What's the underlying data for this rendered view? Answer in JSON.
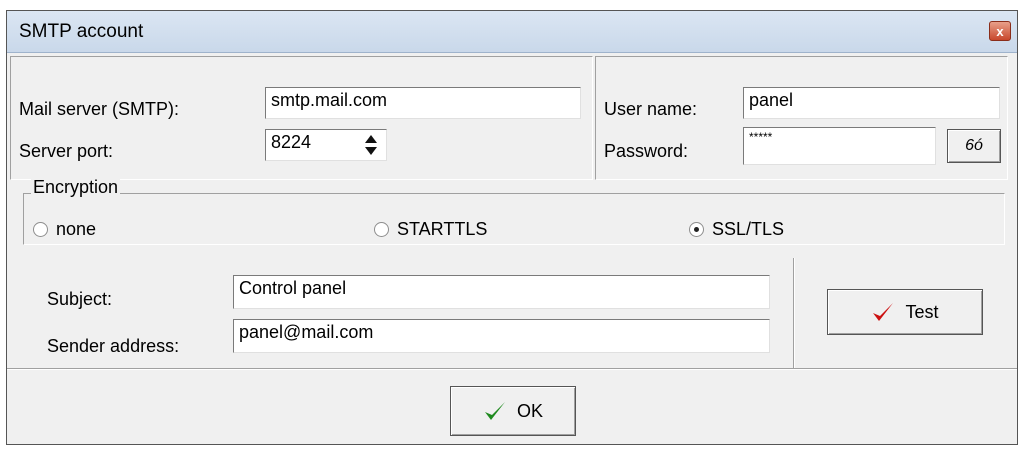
{
  "window": {
    "title": "SMTP account",
    "close_label": "x"
  },
  "server": {
    "mail_server_label": "Mail server (SMTP):",
    "mail_server_value": "smtp.mail.com",
    "port_label": "Server port:",
    "port_value": "8224"
  },
  "auth": {
    "user_label": "User name:",
    "user_value": "panel",
    "password_label": "Password:",
    "password_value": "*****",
    "reveal_label": "6ó"
  },
  "encryption": {
    "group_label": "Encryption",
    "options": [
      {
        "label": "none",
        "selected": false
      },
      {
        "label": "STARTTLS",
        "selected": false
      },
      {
        "label": "SSL/TLS",
        "selected": true
      }
    ]
  },
  "message": {
    "subject_label": "Subject:",
    "subject_value": "Control panel",
    "sender_label": "Sender address:",
    "sender_value": "panel@mail.com"
  },
  "buttons": {
    "test_label": "Test",
    "ok_label": "OK"
  },
  "colors": {
    "checkmark_red": "#cc1111",
    "checkmark_green": "#1f8a1f"
  }
}
